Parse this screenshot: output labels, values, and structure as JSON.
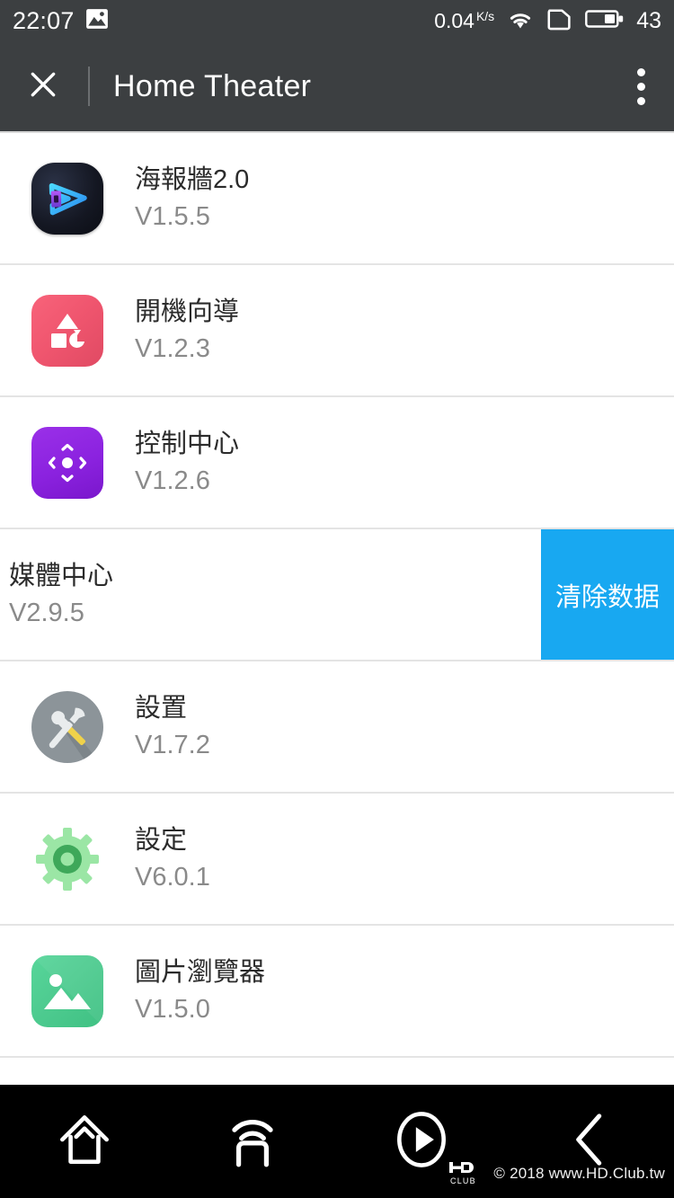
{
  "status_bar": {
    "time": "22:07",
    "image_icon": "image-icon",
    "network_speed": "0.04",
    "network_speed_unit": "K/s",
    "wifi_icon": "wifi-icon",
    "sim_icon": "sim-card-icon",
    "battery_icon": "battery-icon",
    "battery_level": "43",
    "background": "#3c3f41"
  },
  "app_bar": {
    "close_icon": "close-icon",
    "title": "Home Theater",
    "overflow_icon": "overflow-menu-icon",
    "background": "#3c3f41"
  },
  "list": {
    "apps": [
      {
        "name": "海報牆2.0",
        "version": "V1.5.5",
        "icon": "poster-wall-icon",
        "swiped": false
      },
      {
        "name": "開機向導",
        "version": "V1.2.3",
        "icon": "setup-wizard-icon",
        "swiped": false
      },
      {
        "name": "控制中心",
        "version": "V1.2.6",
        "icon": "control-center-icon",
        "swiped": false
      },
      {
        "name": "媒體中心",
        "version": "V2.9.5",
        "icon": "media-center-icon",
        "swiped": true,
        "action_label": "清除数据"
      },
      {
        "name": "設置",
        "version": "V1.7.2",
        "icon": "tools-settings-icon",
        "swiped": false
      },
      {
        "name": "設定",
        "version": "V6.0.1",
        "icon": "gear-settings-icon",
        "swiped": false
      },
      {
        "name": "圖片瀏覽器",
        "version": "V1.5.0",
        "icon": "gallery-icon",
        "swiped": false
      }
    ],
    "action_button_color": "#18a8f1"
  },
  "nav_bar": {
    "background": "#000000",
    "buttons": [
      {
        "icon": "home-icon",
        "label": "Home"
      },
      {
        "icon": "remote-signal-icon",
        "label": "Remote"
      },
      {
        "icon": "play-circle-icon",
        "label": "Play"
      },
      {
        "icon": "back-chevron-icon",
        "label": "Back"
      }
    ]
  },
  "watermark": {
    "logo_top": "HD",
    "logo_bottom": "CLUB",
    "text": "© 2018 www.HD.Club.tw"
  }
}
